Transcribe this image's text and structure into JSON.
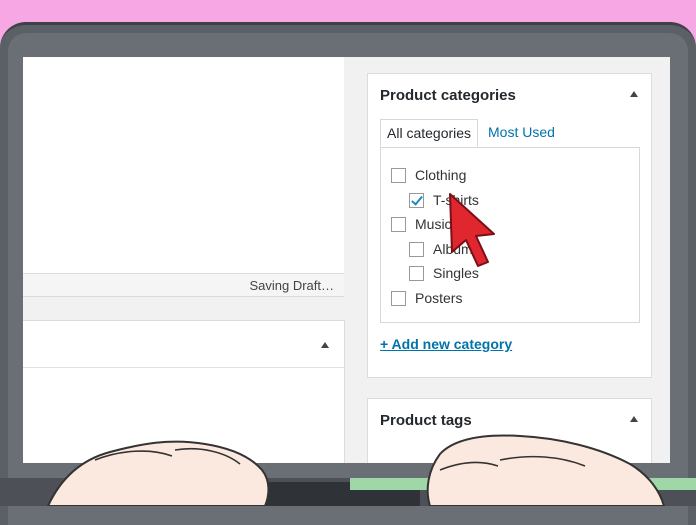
{
  "editor": {
    "status_text": "Saving Draft…"
  },
  "categories_panel": {
    "title": "Product categories",
    "tabs": [
      {
        "label": "All categories",
        "active": true
      },
      {
        "label": "Most Used",
        "active": false
      }
    ],
    "categories": [
      {
        "label": "Clothing",
        "checked": false,
        "level": 0
      },
      {
        "label": "T-shirts",
        "checked": true,
        "level": 1
      },
      {
        "label": "Music",
        "checked": false,
        "level": 0
      },
      {
        "label": "Albums",
        "checked": false,
        "level": 1
      },
      {
        "label": "Singles",
        "checked": false,
        "level": 1
      },
      {
        "label": "Posters",
        "checked": false,
        "level": 0
      }
    ],
    "add_link": "+ Add new category"
  },
  "tags_panel": {
    "title": "Product tags"
  },
  "colors": {
    "link": "#0073aa",
    "pointer": "#e0262f",
    "background": "#f7a7e4"
  },
  "icons": [
    "collapse-arrow-icon",
    "checkmark-icon",
    "mouse-pointer-icon"
  ]
}
